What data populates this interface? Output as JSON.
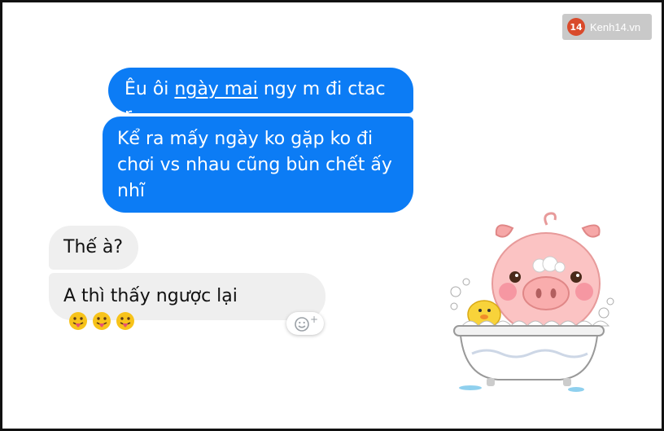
{
  "watermark": {
    "badge": "14",
    "text": "Kenh14.vn"
  },
  "messages": [
    {
      "side": "outgoing",
      "pre": "Êu ôi ",
      "link": "ngày mai",
      "post": " ngy m đi ctac r"
    },
    {
      "side": "outgoing",
      "lines": [
        "Kể ra mấy ngày ko gặp ko đi",
        "chơi vs nhau cũng bùn chết ấy",
        "nhĩ"
      ]
    },
    {
      "side": "incoming",
      "text": "Thế à?"
    },
    {
      "side": "incoming",
      "text": "A thì thấy ngược lại"
    }
  ],
  "colors": {
    "outgoing": "#0c7cf5",
    "incoming": "#efefef",
    "frame": "#111111"
  },
  "icons": [
    "tongue-emoji-icon",
    "add-reaction-icon",
    "pig-bath-sticker"
  ],
  "reaction": {
    "plus": "+"
  }
}
